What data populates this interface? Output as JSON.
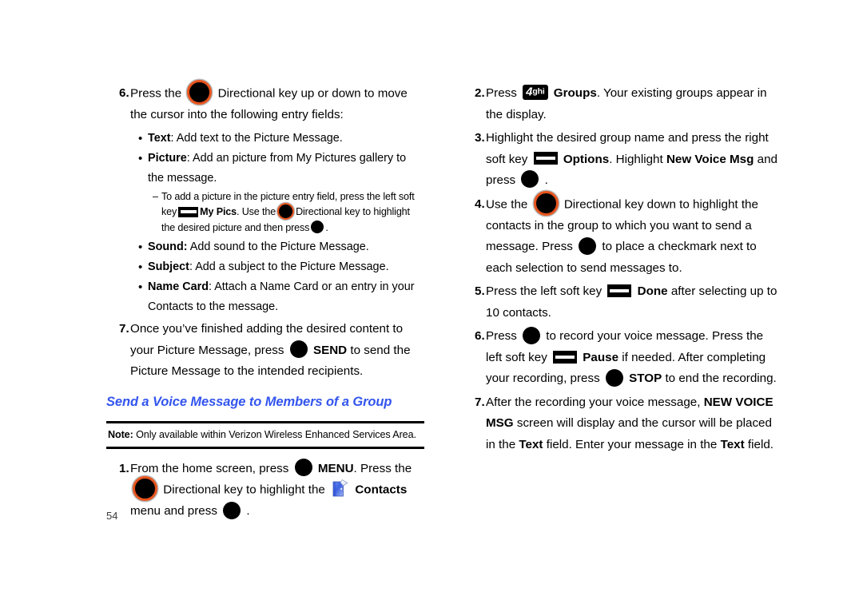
{
  "page": {
    "number": "54",
    "heading": "Send a Voice Message to Members of a Group",
    "heading_color": "#3355ee",
    "note": {
      "label": "Note:",
      "text": "Only available within Verizon Wireless Enhanced Services Area."
    }
  },
  "left_column": {
    "step6": {
      "num": "6.",
      "t1": "Press the",
      "icon1": "directional-key-icon",
      "t2": "Directional key up or down to move the cursor into the following entry fields:",
      "bullets": [
        {
          "dot": "•",
          "label": "Text",
          "sep": ":",
          "text": " Add text to the Picture Message."
        },
        {
          "dot": "•",
          "label": "Picture",
          "sep": ":",
          "text": " Add an picture from My Pictures gallery to the message."
        },
        {
          "dot": "•",
          "label": "Sound:",
          "sep": "",
          "text": " Add sound to the Picture Message."
        },
        {
          "dot": "•",
          "label": "Subject",
          "sep": ":",
          "text": " Add a subject to the Picture Message."
        },
        {
          "dot": "•",
          "label": "Name Card",
          "sep": ":",
          "text": " Attach a Name Card or an entry in your Contacts to the message."
        }
      ],
      "subbullet": {
        "dash": "–",
        "s1": "To add a picture in the picture entry field, press the left soft key",
        "icon_softkey": "soft-key-icon",
        "s2_bold": "My Pics",
        "s3": ". Use the",
        "icon_dkey": "directional-key-icon",
        "s4": "Directional key to highlight the desired picture and then press",
        "icon_ok": "ok-key-icon",
        "s5": "."
      }
    },
    "step7": {
      "num": "7.",
      "t1": "Once you’ve finished adding the desired content to your Picture Message, press",
      "icon_ok": "ok-key-icon",
      "t2_bold": "SEND",
      "t3": "to send the Picture Message to the intended recipients."
    },
    "step1": {
      "num": "1.",
      "t1": "From the home screen, press",
      "icon_ok": "ok-key-icon",
      "t2_bold": "MENU",
      "t3": ". Press the",
      "icon_dkey": "directional-key-icon",
      "t4": "Directional key to highlight the",
      "icon_contacts": "contacts-book-icon",
      "t5_bold": "Contacts",
      "t6": "menu and press",
      "icon_ok2": "ok-key-icon",
      "t7": "."
    }
  },
  "right_column": {
    "step2": {
      "num": "2.",
      "t1": "Press",
      "key_digit": "4",
      "key_letters": "ghi",
      "t2_bold": "Groups",
      "t3": ". Your existing groups appear in the display."
    },
    "step3": {
      "num": "3.",
      "t1": "Highlight the desired group name and press the right soft key",
      "icon_softkey": "soft-key-icon",
      "t2_bold": "Options",
      "t3": ". Highlight",
      "t4_bold": "New Voice Msg",
      "t5": "and press",
      "icon_ok": "ok-key-icon",
      "t6": "."
    },
    "step4": {
      "num": "4.",
      "t1": "Use the",
      "icon_dkey": "directional-key-icon",
      "t2": "Directional key down to highlight the contacts in the group to which you want to send a message. Press",
      "icon_ok": "ok-key-icon",
      "t3": "to place a checkmark next to each selection to send messages to."
    },
    "step5": {
      "num": "5.",
      "t1": "Press the left soft key",
      "icon_softkey": "soft-key-icon",
      "t2_bold": "Done",
      "t3": "after selecting up to 10 contacts."
    },
    "step6": {
      "num": "6.",
      "t1": "Press",
      "icon_ok": "ok-key-icon",
      "t2": "to record your voice message. Press the left soft key",
      "icon_softkey": "soft-key-icon",
      "t3_bold": "Pause",
      "t4": "if needed. After completing your recording, press",
      "icon_ok2": "ok-key-icon",
      "t5_bold": "STOP",
      "t6": "to end the recording."
    },
    "step7": {
      "num": "7.",
      "t1": "After the recording your voice message,",
      "t2_bold": "NEW VOICE MSG",
      "t3": "screen will display and the cursor will be placed in the",
      "t4_bold": "Text",
      "t5": "field. Enter your message in the",
      "t6_bold": "Text",
      "t7": "field."
    }
  }
}
